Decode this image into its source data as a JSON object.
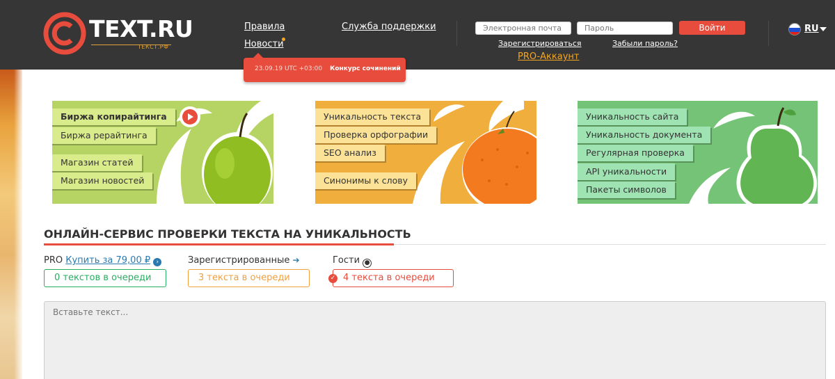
{
  "header": {
    "logo_text": "TEXT.RU",
    "logo_sub": "ТЕКСТ.РФ",
    "nav": {
      "rules": "Правила",
      "news": "Новости",
      "support": "Служба поддержки"
    },
    "email_placeholder": "Электронная почта",
    "password_placeholder": "Пароль",
    "login_button": "Войти",
    "register_link": "Зарегистрироваться",
    "forgot_link": "Забыли пароль?",
    "pro_link": "PRO-Аккаунт",
    "lang": "RU",
    "news_popup": {
      "date": "23.09.19 UTC +03:00",
      "title": "Конкурс сочинений"
    }
  },
  "panels": {
    "left": {
      "items": [
        "Биржа копирайтинга",
        "Биржа рерайтинга",
        "Магазин статей",
        "Магазин новостей"
      ]
    },
    "middle": {
      "items": [
        "Уникальность текста",
        "Проверка орфографии",
        "SEO анализ",
        "Синонимы к слову"
      ]
    },
    "right": {
      "items": [
        "Уникальность сайта",
        "Уникальность документа",
        "Регулярная проверка",
        "API уникальности",
        "Пакеты символов"
      ]
    }
  },
  "main": {
    "title": "ОНЛАЙН-СЕРВИС ПРОВЕРКИ ТЕКСТА НА УНИКАЛЬНОСТЬ",
    "queues": {
      "pro_label": "PRO",
      "pro_buy": "Купить за 79,00 ₽",
      "pro_count": "0 текстов в очереди",
      "registered_label": "Зарегистрированные",
      "registered_count": "3 текста в очереди",
      "guests_label": "Гости",
      "guests_count": "4 текста в очереди"
    },
    "textarea_placeholder": "Вставьте текст..."
  },
  "colors": {
    "header_bg": "#363636",
    "accent_red": "#e74c3c",
    "green_panel": "#b5d463",
    "orange_panel": "#f0ae3c",
    "green2_panel": "#74c377"
  }
}
